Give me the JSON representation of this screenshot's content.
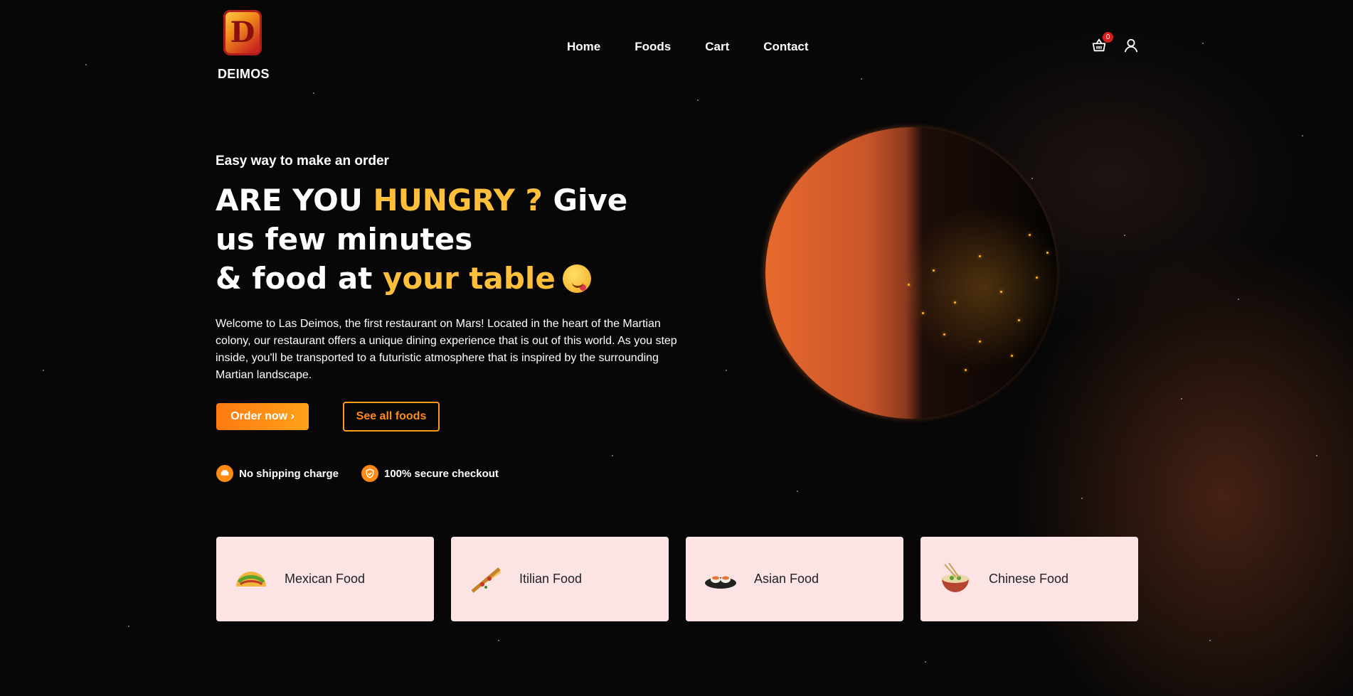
{
  "brand": {
    "name": "DEIMOS",
    "logo_letter": "D"
  },
  "nav": {
    "items": [
      {
        "label": "Home"
      },
      {
        "label": "Foods"
      },
      {
        "label": "Cart"
      },
      {
        "label": "Contact"
      }
    ]
  },
  "header": {
    "cart_count": "0",
    "cart_icon": "basket-icon",
    "user_icon": "user-icon"
  },
  "hero": {
    "subtitle": "Easy way to make an order",
    "headline": {
      "part1": "ARE YOU ",
      "part2": "HUNGRY ?",
      "part3": " Give us few minutes",
      "part4": "& food at ",
      "part5": "your table"
    },
    "description": "Welcome to Las Deimos, the first restaurant on Mars! Located in the heart of the Martian colony, our restaurant offers a unique dining experience that is out of this world. As you step inside, you'll be transported to a futuristic atmosphere that is inspired by the surrounding Martian landscape.",
    "order_button": "Order now ›",
    "see_all_button": "See all foods",
    "features": [
      {
        "label": "No shipping charge",
        "icon": "car-icon"
      },
      {
        "label": "100% secure checkout",
        "icon": "shield-icon"
      }
    ]
  },
  "categories": [
    {
      "label": "Mexican Food",
      "icon": "taco-icon"
    },
    {
      "label": "Itilian Food",
      "icon": "pizza-icon"
    },
    {
      "label": "Asian Food",
      "icon": "sushi-icon"
    },
    {
      "label": "Chinese Food",
      "icon": "noodle-bowl-icon"
    }
  ],
  "colors": {
    "accent": "#ffbf3b",
    "button": "#ff8a14",
    "card_bg": "#fde4e4",
    "background": "#070707"
  }
}
